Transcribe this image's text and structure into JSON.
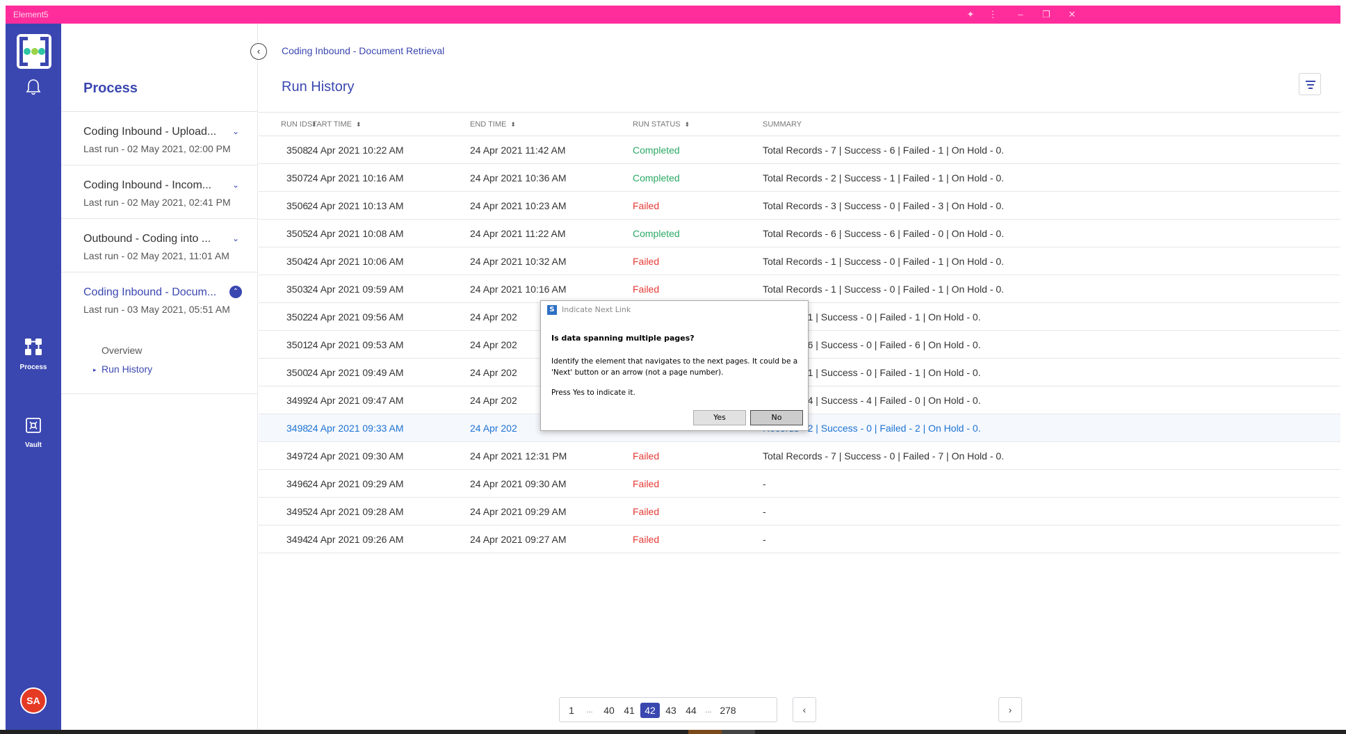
{
  "window": {
    "title": "Element5"
  },
  "rail": {
    "process_label": "Process",
    "vault_label": "Vault",
    "avatar_initials": "SA"
  },
  "sidebar": {
    "title": "Process",
    "processes": [
      {
        "name": "Coding Inbound - Upload...",
        "last_run": "Last run - 02 May 2021, 02:00 PM"
      },
      {
        "name": "Coding Inbound - Incom...",
        "last_run": "Last run - 02 May 2021, 02:41 PM"
      },
      {
        "name": "Outbound - Coding into ...",
        "last_run": "Last run - 02 May 2021, 11:01 AM"
      },
      {
        "name": "Coding Inbound - Docum...",
        "last_run": "Last run - 03 May 2021, 05:51 AM"
      }
    ],
    "sub_items": [
      "Overview",
      "Run History"
    ]
  },
  "main": {
    "breadcrumb": "Coding Inbound - Document Retrieval",
    "title": "Run History",
    "columns": [
      "RUN ID",
      "START TIME",
      "END TIME",
      "RUN STATUS",
      "SUMMARY"
    ],
    "rows": [
      [
        "3508",
        "24 Apr 2021 10:22 AM",
        "24 Apr 2021 11:42 AM",
        "Completed",
        "Total Records - 7 | Success - 6 | Failed - 1 | On Hold - 0."
      ],
      [
        "3507",
        "24 Apr 2021 10:16 AM",
        "24 Apr 2021 10:36 AM",
        "Completed",
        "Total Records - 2 | Success - 1 | Failed - 1 | On Hold - 0."
      ],
      [
        "3506",
        "24 Apr 2021 10:13 AM",
        "24 Apr 2021 10:23 AM",
        "Failed",
        "Total Records - 3 | Success - 0 | Failed - 3 | On Hold - 0."
      ],
      [
        "3505",
        "24 Apr 2021 10:08 AM",
        "24 Apr 2021 11:22 AM",
        "Completed",
        "Total Records - 6 | Success - 6 | Failed - 0 | On Hold - 0."
      ],
      [
        "3504",
        "24 Apr 2021 10:06 AM",
        "24 Apr 2021 10:32 AM",
        "Failed",
        "Total Records - 1 | Success - 0 | Failed - 1 | On Hold - 0."
      ],
      [
        "3503",
        "24 Apr 2021 09:59 AM",
        "24 Apr 2021 10:16 AM",
        "Failed",
        "Total Records - 1 | Success - 0 | Failed - 1 | On Hold - 0."
      ],
      [
        "3502",
        "24 Apr 2021 09:56 AM",
        "24 Apr 202",
        "",
        "Records - 1 | Success - 0 | Failed - 1 | On Hold - 0."
      ],
      [
        "3501",
        "24 Apr 2021 09:53 AM",
        "24 Apr 202",
        "",
        "Records - 6 | Success - 0 | Failed - 6 | On Hold - 0."
      ],
      [
        "3500",
        "24 Apr 2021 09:49 AM",
        "24 Apr 202",
        "",
        "Records - 1 | Success - 0 | Failed - 1 | On Hold - 0."
      ],
      [
        "3499",
        "24 Apr 2021 09:47 AM",
        "24 Apr 202",
        "",
        "Records - 4 | Success - 4 | Failed - 0 | On Hold - 0."
      ],
      [
        "3498",
        "24 Apr 2021 09:33 AM",
        "24 Apr 202",
        "",
        "Records - 2 | Success - 0 | Failed - 2 | On Hold - 0."
      ],
      [
        "3497",
        "24 Apr 2021 09:30 AM",
        "24 Apr 2021 12:31 PM",
        "Failed",
        "Total Records - 7 | Success - 0 | Failed - 7 | On Hold - 0."
      ],
      [
        "3496",
        "24 Apr 2021 09:29 AM",
        "24 Apr 2021 09:30 AM",
        "Failed",
        "-"
      ],
      [
        "3495",
        "24 Apr 2021 09:28 AM",
        "24 Apr 2021 09:29 AM",
        "Failed",
        "-"
      ],
      [
        "3494",
        "24 Apr 2021 09:26 AM",
        "24 Apr 2021 09:27 AM",
        "Failed",
        "-"
      ]
    ],
    "pagination": {
      "prev_label": "‹",
      "next_label": "›",
      "pages": [
        "1",
        "...",
        "40",
        "41",
        "42",
        "43",
        "44",
        "...",
        "278"
      ],
      "current": "42"
    }
  },
  "dialog": {
    "title": "Indicate Next Link",
    "question": "Is data spanning multiple pages?",
    "body": "Identify the element that navigates to the next pages. It could be a 'Next' button or an arrow (not a page number).",
    "press": "Press Yes to indicate it.",
    "yes_label": "Yes",
    "no_label": "No"
  },
  "colors": {
    "titlebar": "#ff2d9b",
    "rail": "#3a47b0",
    "accent": "#3a47b0",
    "completed": "#2aa864",
    "failed": "#e53935",
    "highlight_row_text": "#1e73d3"
  },
  "icons": {
    "bell": "bell-icon",
    "process": "process-icon",
    "vault": "vault-icon",
    "filter": "filter-icon",
    "back": "back-arrow-icon"
  }
}
